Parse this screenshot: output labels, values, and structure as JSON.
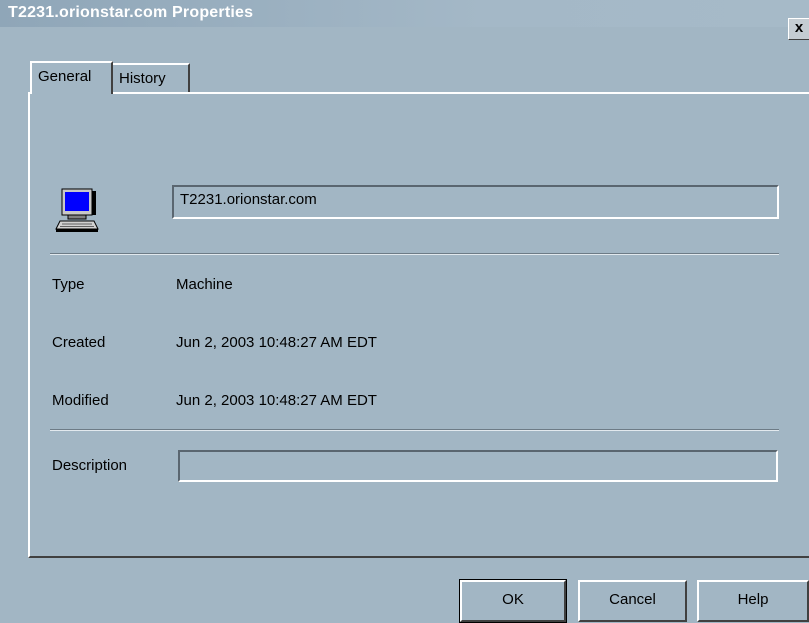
{
  "window": {
    "title": "T2231.orionstar.com Properties",
    "close_label": "x"
  },
  "tabs": [
    {
      "label": "General",
      "selected": true
    },
    {
      "label": "History",
      "selected": false
    }
  ],
  "general": {
    "icon": "computer-icon",
    "name_value": "T2231.orionstar.com",
    "type_label": "Type",
    "type_value": "Machine",
    "created_label": "Created",
    "created_value": "Jun 2, 2003 10:48:27 AM EDT",
    "modified_label": "Modified",
    "modified_value": "Jun 2, 2003 10:48:27 AM EDT",
    "description_label": "Description",
    "description_value": ""
  },
  "buttons": {
    "ok": "OK",
    "cancel": "Cancel",
    "help": "Help"
  },
  "colors": {
    "background": "#a2b6c4",
    "title_text": "#ffffff",
    "monitor_screen": "#0000ff"
  }
}
